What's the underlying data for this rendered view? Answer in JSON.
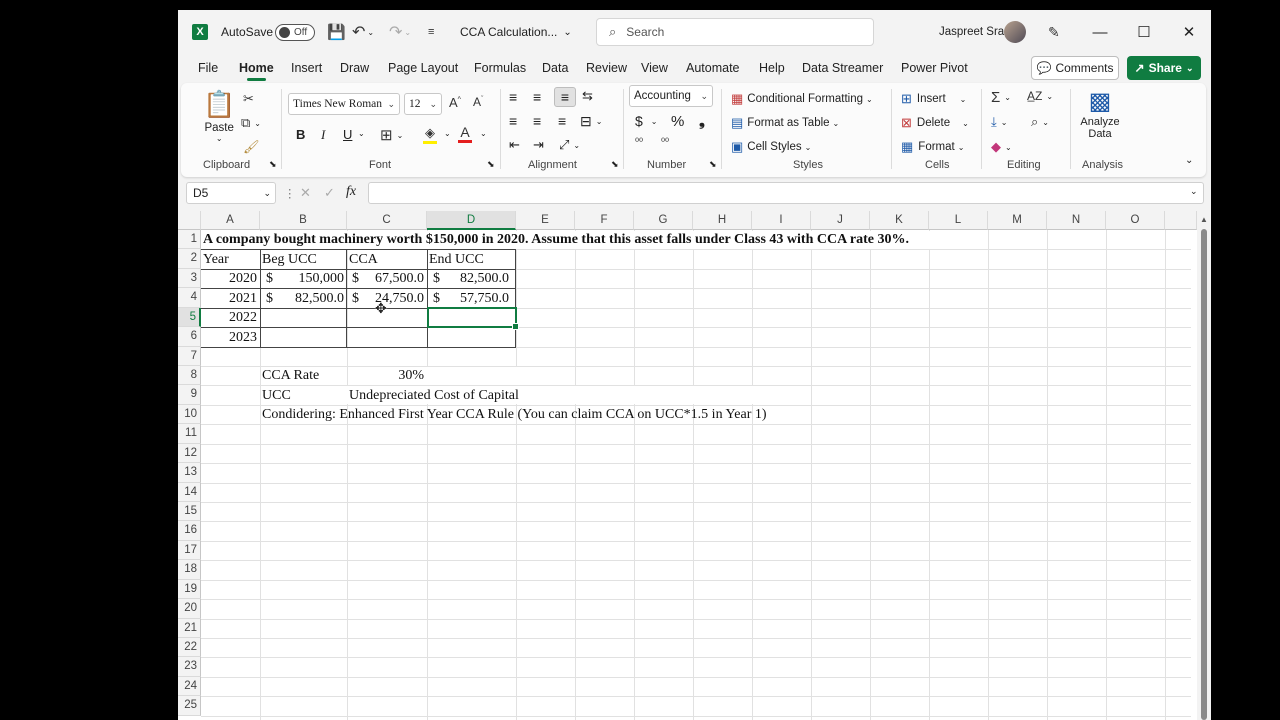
{
  "titlebar": {
    "autosave_label": "AutoSave",
    "autosave_state": "Off",
    "file_name": "CCA Calculation...",
    "search_placeholder": "Search",
    "user_name": "Jaspreet Sra"
  },
  "menu": {
    "items": [
      "File",
      "Home",
      "Insert",
      "Draw",
      "Page Layout",
      "Formulas",
      "Data",
      "Review",
      "View",
      "Automate",
      "Help",
      "Data Streamer",
      "Power Pivot"
    ],
    "active": "Home",
    "comments_label": "Comments",
    "share_label": "Share"
  },
  "ribbon": {
    "clipboard": {
      "paste": "Paste",
      "label": "Clipboard"
    },
    "font": {
      "name": "Times New Roman",
      "size": "12",
      "label": "Font",
      "bold": "B",
      "italic": "I",
      "underline": "U"
    },
    "alignment": {
      "label": "Alignment"
    },
    "number": {
      "format": "Accounting",
      "label": "Number",
      "currency": "$",
      "percent": "%"
    },
    "styles": {
      "conditional": "Conditional Formatting",
      "table": "Format as Table",
      "cell": "Cell Styles",
      "label": "Styles"
    },
    "cells": {
      "insert": "Insert",
      "delete": "Delete",
      "format": "Format",
      "label": "Cells"
    },
    "editing": {
      "label": "Editing"
    },
    "analysis": {
      "analyze_line1": "Analyze",
      "analyze_line2": "Data",
      "label": "Analysis"
    }
  },
  "formula_bar": {
    "name_box": "D5",
    "formula": ""
  },
  "sheet": {
    "columns": [
      "A",
      "B",
      "C",
      "D",
      "E",
      "F",
      "G",
      "H",
      "I",
      "J",
      "K",
      "L",
      "M",
      "N",
      "O"
    ],
    "selected_column": "D",
    "rows": [
      "1",
      "2",
      "3",
      "4",
      "5",
      "6",
      "7",
      "8",
      "9",
      "10",
      "11",
      "12",
      "13",
      "14",
      "15",
      "16",
      "17",
      "18",
      "19",
      "20",
      "21",
      "22",
      "23",
      "24",
      "25"
    ],
    "selected_row": "5",
    "title": "A company bought machinery worth $150,000 in 2020. Assume that this asset falls under Class 43 with CCA rate 30%.",
    "headers": {
      "year": "Year",
      "beg": "Beg UCC",
      "cca": "CCA",
      "end": "End UCC"
    },
    "data_rows": [
      {
        "year": "2020",
        "beg_sym": "$",
        "beg": "150,000",
        "cca_sym": "$",
        "cca": "67,500.0",
        "end_sym": "$",
        "end": "82,500.0"
      },
      {
        "year": "2021",
        "beg_sym": "$",
        "beg": "82,500.0",
        "cca_sym": "$",
        "cca": "24,750.0",
        "end_sym": "$",
        "end": "57,750.0"
      },
      {
        "year": "2022"
      },
      {
        "year": "2023"
      }
    ],
    "cca_rate_label": "CCA Rate",
    "cca_rate_value": "30%",
    "ucc_label": "UCC",
    "ucc_desc": "Undepreciated Cost of Capital",
    "note": "Condidering: Enhanced First Year CCA Rule (You can claim CCA on UCC*1.5 in Year 1)"
  }
}
